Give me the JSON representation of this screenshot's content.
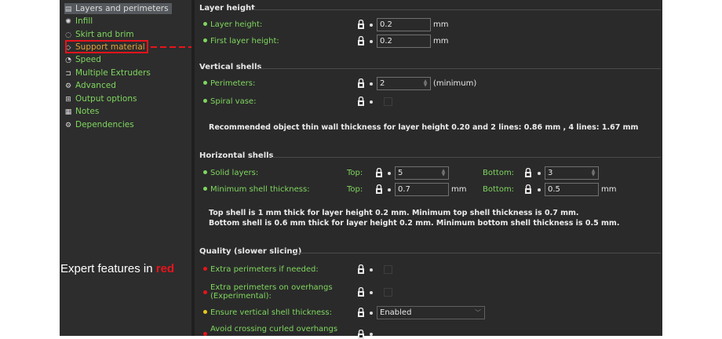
{
  "sidebar": {
    "items": [
      {
        "label": "Layers and perimeters",
        "icon": "layers-icon",
        "glyph": "▤"
      },
      {
        "label": "Infill",
        "icon": "infill-icon",
        "glyph": "✺"
      },
      {
        "label": "Skirt and brim",
        "icon": "skirt-icon",
        "glyph": "◌"
      },
      {
        "label": "Support material",
        "icon": "support-icon",
        "glyph": "◇"
      },
      {
        "label": "Speed",
        "icon": "speed-icon",
        "glyph": "◔"
      },
      {
        "label": "Multiple Extruders",
        "icon": "extruder-icon",
        "glyph": "⊐"
      },
      {
        "label": "Advanced",
        "icon": "advanced-icon",
        "glyph": "⚙"
      },
      {
        "label": "Output options",
        "icon": "output-icon",
        "glyph": "⊞"
      },
      {
        "label": "Notes",
        "icon": "notes-icon",
        "glyph": "▦"
      },
      {
        "label": "Dependencies",
        "icon": "dependencies-icon",
        "glyph": "⚙"
      }
    ]
  },
  "annotation": {
    "prefix": "Expert features in ",
    "highlight": "red"
  },
  "layer_height": {
    "title": "Layer height",
    "layer_height_label": "Layer height:",
    "layer_height_value": "0.2",
    "layer_height_unit": "mm",
    "first_layer_label": "First layer height:",
    "first_layer_value": "0.2",
    "first_layer_unit": "mm"
  },
  "vertical_shells": {
    "title": "Vertical shells",
    "perimeters_label": "Perimeters:",
    "perimeters_value": "2",
    "perimeters_unit": "(minimum)",
    "spiral_label": "Spiral vase:",
    "info": "Recommended object thin wall thickness for layer height 0.20 and 2 lines: 0.86 mm , 4 lines: 1.67 mm"
  },
  "horizontal_shells": {
    "title": "Horizontal shells",
    "solid_label": "Solid layers:",
    "top_label": "Top:",
    "top_value": "5",
    "bottom_label": "Bottom:",
    "bottom_value": "3",
    "min_label": "Minimum shell thickness:",
    "min_top_value": "0.7",
    "min_top_unit": "mm",
    "min_bottom_value": "0.5",
    "min_bottom_unit": "mm",
    "info_line1": "Top shell is 1 mm thick for layer height 0.2 mm. Minimum top shell thickness is 0.7 mm.",
    "info_line2": "Bottom shell is 0.6 mm thick for layer height 0.2 mm. Minimum bottom shell thickness is 0.5 mm."
  },
  "quality": {
    "title": "Quality (slower slicing)",
    "extra_perim_label": "Extra perimeters if needed:",
    "overhang_label_1": "Extra perimeters on overhangs",
    "overhang_label_2": "(Experimental):",
    "ensure_label": "Ensure vertical shell thickness:",
    "ensure_value": "Enabled",
    "avoid_label": "Avoid crossing curled overhangs"
  },
  "colors": {
    "accent_green": "#7fd75f",
    "expert_red": "#e8141c",
    "advanced_yellow": "#e8c71a",
    "panel": "#2a2a2a"
  }
}
